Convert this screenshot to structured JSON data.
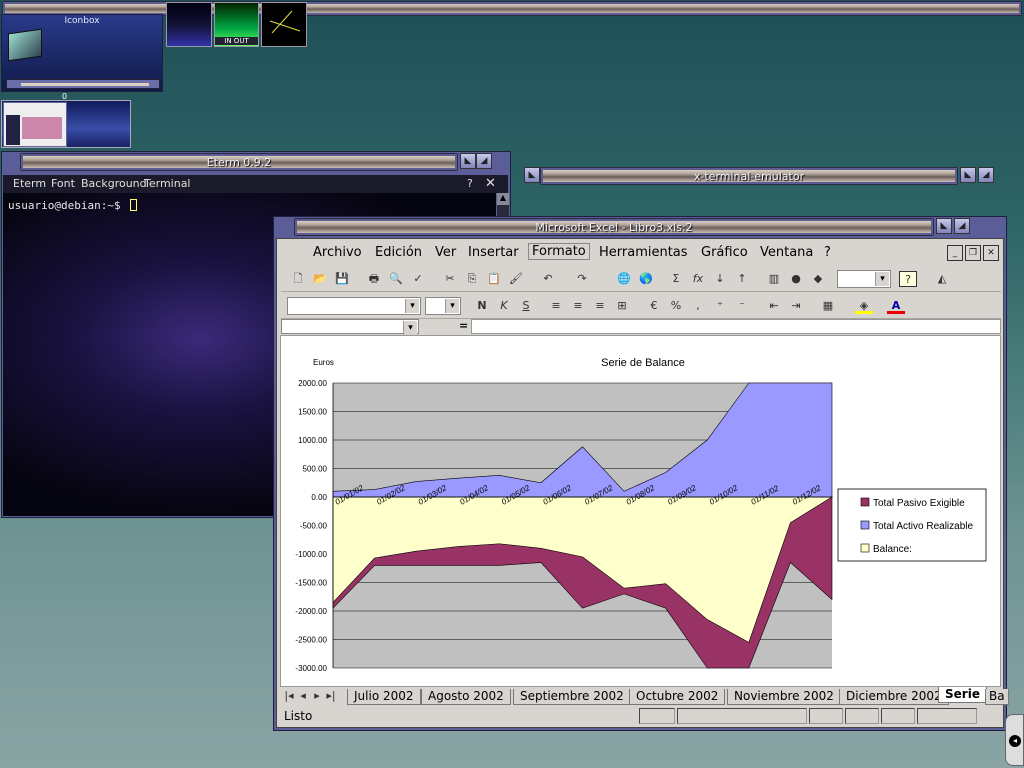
{
  "top_bar_title": "",
  "iconbox": {
    "title": "Iconbox"
  },
  "pager": {
    "label": "0"
  },
  "monitor": {
    "in_out": "IN OUT"
  },
  "eterm": {
    "title": "Eterm 0.9.2",
    "menu": [
      "Eterm",
      "Font",
      "Background",
      "Terminal"
    ],
    "help": "?",
    "close": "✕",
    "prompt": "usuario@debian:~$"
  },
  "xterm": {
    "title": "x-terminal-emulator"
  },
  "excel": {
    "title": "Microsoft Excel - Libro3.xls:2",
    "menu": [
      "Archivo",
      "Edición",
      "Ver",
      "Insertar",
      "Formato",
      "Herramientas",
      "Gráfico",
      "Ventana",
      "?"
    ],
    "formula_eq": "=",
    "tabs": [
      "Julio 2002",
      "Agosto 2002",
      "Septiembre 2002",
      "Octubre 2002",
      "Noviembre 2002",
      "Diciembre 2002",
      "Serie",
      "Ba"
    ],
    "active_tab": "Serie",
    "status": "Listo"
  },
  "chart_data": {
    "type": "area",
    "title": "Serie de Balance",
    "ylabel": "Euros",
    "xlabel": "",
    "ylim": [
      -3000,
      2000
    ],
    "yticks": [
      2000,
      1500,
      1000,
      500,
      0,
      -500,
      -1000,
      -1500,
      -2000,
      -2500,
      -3000
    ],
    "ytick_labels": [
      "2000.00",
      "1500.00",
      "1000.00",
      "500.00",
      "0.00",
      "-500.00",
      "-1000.00",
      "-1500.00",
      "-2000.00",
      "-2500.00",
      "-3000.00"
    ],
    "categories": [
      "01/01/02",
      "01/02/02",
      "01/03/02",
      "01/04/02",
      "01/05/02",
      "01/06/02",
      "01/07/02",
      "01/08/02",
      "01/09/02",
      "01/10/02",
      "01/11/02",
      "01/12/02"
    ],
    "x_points": [
      0,
      1,
      2,
      3,
      4,
      5,
      6,
      7,
      8,
      9,
      10,
      11,
      12
    ],
    "series": [
      {
        "name": "Total Pasivo Exigible",
        "color": "#993366",
        "values": [
          -1950,
          -1200,
          -1200,
          -1200,
          -1200,
          -1150,
          -1950,
          -1700,
          -1950,
          -3000,
          -3000,
          -1150,
          -1800
        ]
      },
      {
        "name": "Total Activo Realizable",
        "color": "#9999ff",
        "values": [
          100,
          130,
          270,
          330,
          380,
          250,
          880,
          100,
          430,
          1000,
          2000,
          2000,
          2000
        ]
      },
      {
        "name": "Balance:",
        "color": "#ffffcc",
        "values": [
          -1850,
          -1070,
          -950,
          -870,
          -820,
          -900,
          -1050,
          -1600,
          -1520,
          -2150,
          -2550,
          -450,
          0
        ]
      }
    ],
    "legend_position": "right",
    "plot_background": "#c0c0c0",
    "grid": true
  }
}
